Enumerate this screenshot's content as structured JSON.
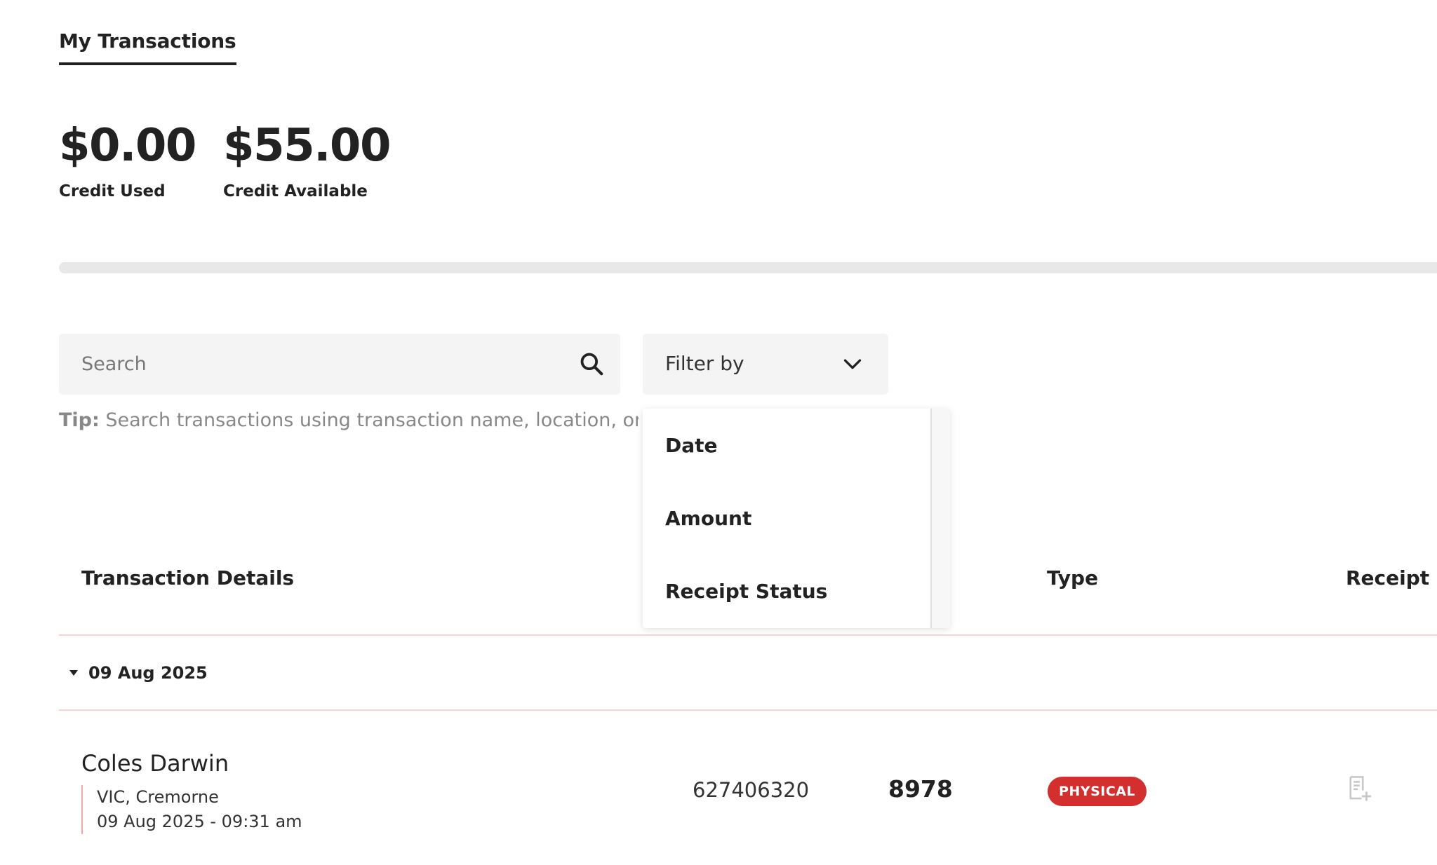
{
  "tabs": {
    "active_label": "My Transactions"
  },
  "credit": {
    "used_amount": "$0.00",
    "used_label": "Credit Used",
    "available_amount": "$55.00",
    "available_label": "Credit Available",
    "usage_fraction": 0
  },
  "search": {
    "placeholder": "Search",
    "tip_prefix": "Tip:",
    "tip_text": " Search transactions using transaction name, location, order"
  },
  "filter": {
    "label": "Filter by",
    "options": [
      "Date",
      "Amount",
      "Receipt Status"
    ]
  },
  "table": {
    "headers": {
      "details": "Transaction Details",
      "type": "Type",
      "receipt": "Receipt"
    },
    "groups": [
      {
        "date": "09 Aug 2025",
        "transactions": [
          {
            "name": "Coles Darwin",
            "location": "VIC, Cremorne",
            "datetime": "09 Aug 2025 - 09:31 am",
            "order_number": "627406320",
            "card": "8978",
            "type": "PHYSICAL"
          }
        ]
      }
    ]
  },
  "colors": {
    "accent": "#d32f2f",
    "field_bg": "#f4f4f4"
  },
  "icons": {
    "search": "search-icon",
    "filter": "chevron-down-icon",
    "group": "caret-down-icon",
    "receipt": "receipt-add-icon"
  }
}
